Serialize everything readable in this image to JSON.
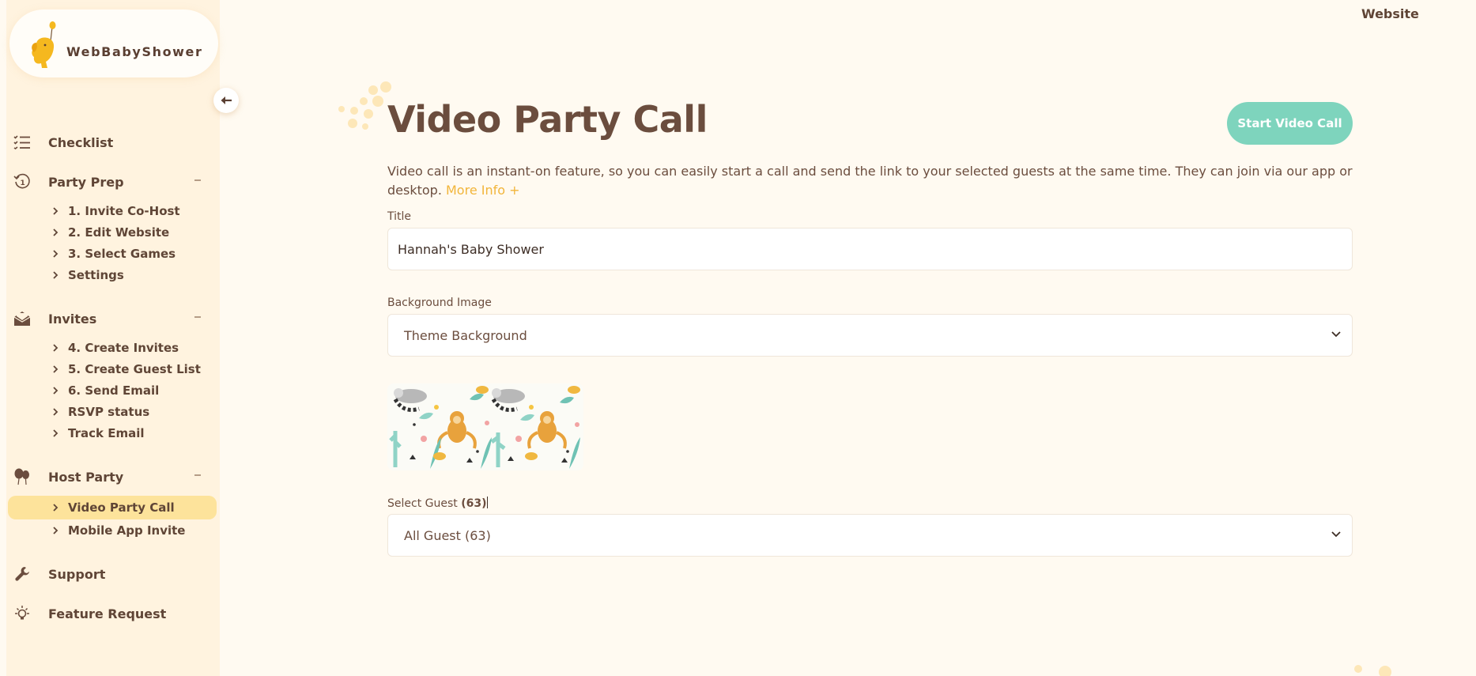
{
  "brand": {
    "name": "WebBabyShower"
  },
  "header": {
    "website_link": "Website"
  },
  "sidebar": {
    "sections": [
      {
        "label": "Checklist",
        "icon": "checklist-icon"
      },
      {
        "label": "Party Prep",
        "icon": "history-icon",
        "items": [
          "1. Invite Co-Host",
          "2. Edit Website",
          "3. Select Games",
          "Settings"
        ]
      },
      {
        "label": "Invites",
        "icon": "envelope-open-icon",
        "items": [
          "4. Create Invites",
          "5. Create Guest List",
          "6. Send Email",
          "RSVP status",
          "Track Email"
        ]
      },
      {
        "label": "Host Party",
        "icon": "balloons-icon",
        "items": [
          "Video Party Call",
          "Mobile App Invite"
        ],
        "active_item": "Video Party Call"
      },
      {
        "label": "Support",
        "icon": "wrench-icon"
      },
      {
        "label": "Feature Request",
        "icon": "lightbulb-icon"
      }
    ]
  },
  "main": {
    "title": "Video Party Call",
    "start_button": "Start Video Call",
    "description": "Video call is an instant-on feature, so you can easily start a call and send the link to your selected guests at the same time. They can join via our app or desktop.",
    "more_info": "More Info +",
    "title_field": {
      "label": "Title",
      "value": "Hannah's Baby Shower"
    },
    "background_field": {
      "label": "Background Image",
      "value": "Theme Background"
    },
    "guest_field": {
      "label": "Select Guest",
      "count": "(63)",
      "value": "All Guest (63)"
    }
  },
  "colors": {
    "accent": "#7ed4bd",
    "highlight": "#fde39b",
    "link": "#f2b53a",
    "text": "#6b4d3e",
    "sidebar_bg": "#fff3df",
    "page_bg": "#fffaf1"
  }
}
